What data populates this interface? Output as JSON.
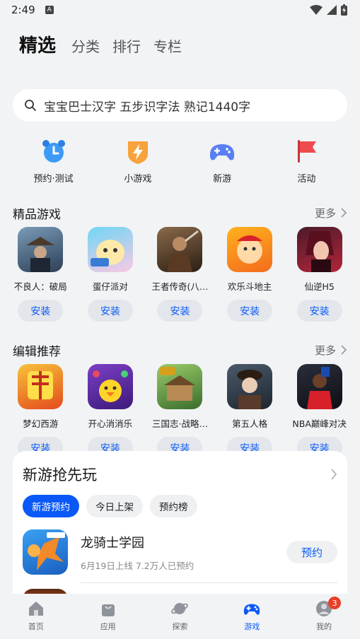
{
  "status": {
    "time": "2:49",
    "notif_badge": "A"
  },
  "top_tabs": [
    {
      "label": "精选",
      "active": true
    },
    {
      "label": "分类"
    },
    {
      "label": "排行"
    },
    {
      "label": "专栏"
    }
  ],
  "search": {
    "placeholder": "宝宝巴士汉字 五步识字法 熟记1440字"
  },
  "quick": [
    {
      "label": "预约·测试",
      "icon": "alarm-clock-icon"
    },
    {
      "label": "小游戏",
      "icon": "lightning-shield-icon"
    },
    {
      "label": "新游",
      "icon": "gamepad-icon"
    },
    {
      "label": "活动",
      "icon": "flag-icon"
    }
  ],
  "featured": {
    "title": "精品游戏",
    "more": "更多",
    "install_label": "安装",
    "apps": [
      {
        "name": "不良人：破局"
      },
      {
        "name": "蛋仔派对"
      },
      {
        "name": "王者传奇(八…"
      },
      {
        "name": "欢乐斗地主"
      },
      {
        "name": "仙逆H5"
      }
    ]
  },
  "editor": {
    "title": "编辑推荐",
    "more": "更多",
    "install_label": "安装",
    "apps": [
      {
        "name": "梦幻西游"
      },
      {
        "name": "开心消消乐"
      },
      {
        "name": "三国志·战略…"
      },
      {
        "name": "第五人格"
      },
      {
        "name": "NBA巅峰对决"
      }
    ]
  },
  "newgames": {
    "title": "新游抢先玩",
    "chips": [
      "新游预约",
      "今日上架",
      "预约榜"
    ],
    "item": {
      "name": "龙骑士学园",
      "meta": "6月19日上线  7.2万人已预约",
      "action": "预约"
    }
  },
  "bottom_nav": [
    {
      "label": "首页"
    },
    {
      "label": "应用"
    },
    {
      "label": "探索"
    },
    {
      "label": "游戏",
      "active": true
    },
    {
      "label": "我的",
      "badge": "3"
    }
  ],
  "colors": {
    "accent": "#0a59f7",
    "background": "#f1f3f5",
    "badge": "#e84026"
  }
}
